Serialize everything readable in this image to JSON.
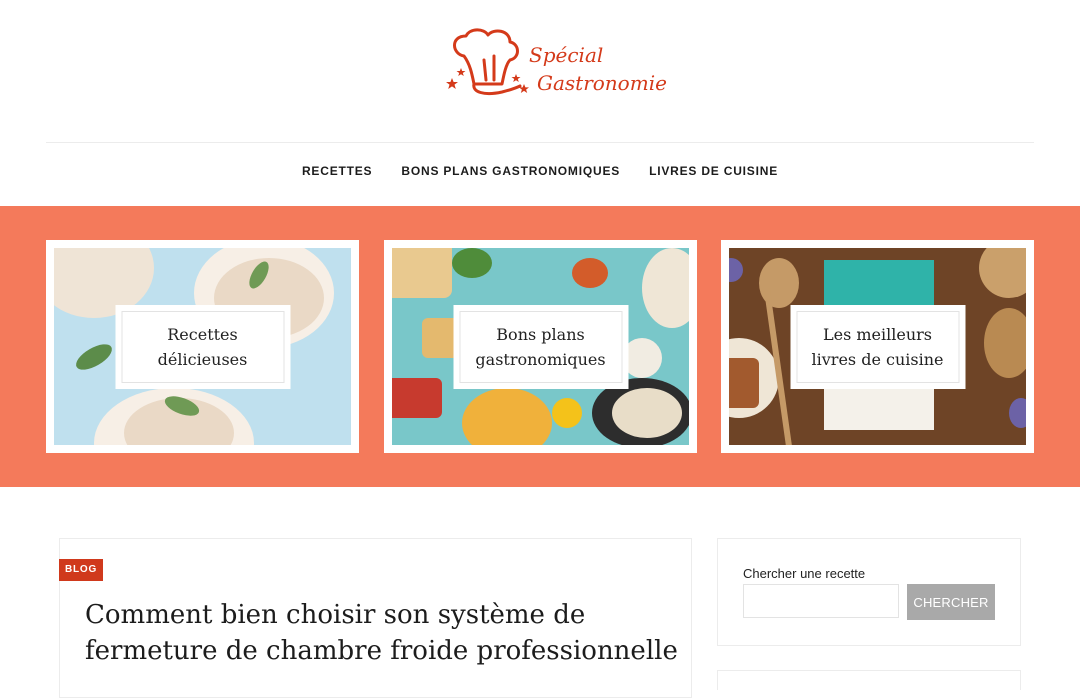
{
  "brand": {
    "name_line1": "Spécial",
    "name_line2": "Gastronomie",
    "accent_color": "#d43a1a"
  },
  "nav": {
    "items": [
      {
        "label": "RECETTES"
      },
      {
        "label": "BONS PLANS GASTRONOMIQUES"
      },
      {
        "label": "LIVRES DE CUISINE"
      }
    ]
  },
  "promo": {
    "band_color": "#f47a5b",
    "boxes": [
      {
        "line1": "Recettes",
        "line2": "délicieuses"
      },
      {
        "line1": "Bons plans",
        "line2": "gastronomiques"
      },
      {
        "line1": "Les meilleurs",
        "line2": "livres de cuisine"
      }
    ]
  },
  "article": {
    "category": "BLOG",
    "category_color": "#d0391c",
    "title": "Comment bien choisir son système de fermeture de chambre froide professionnelle"
  },
  "sidebar": {
    "search_label": "Chercher une recette",
    "search_value": "",
    "search_button": "CHERCHER"
  },
  "icons": [
    "chef-hat-logo-icon",
    "star-icon"
  ]
}
